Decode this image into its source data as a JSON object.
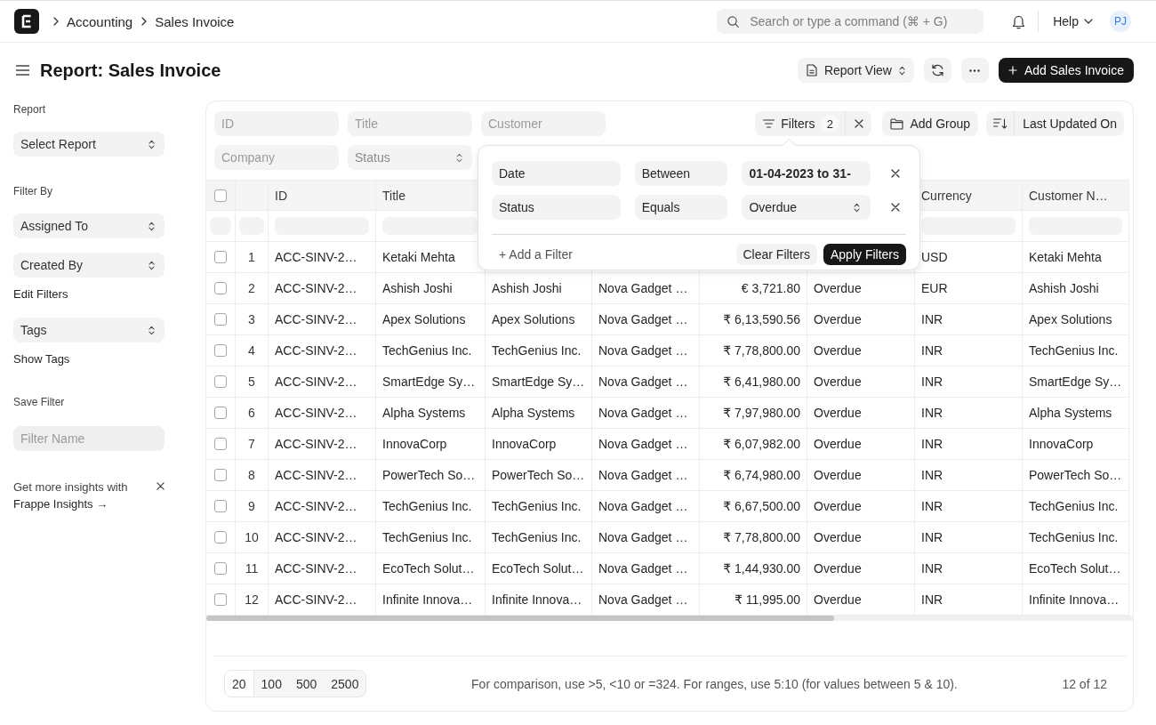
{
  "navbar": {
    "breadcrumbs": [
      "Accounting",
      "Sales Invoice"
    ],
    "search": {
      "placeholder": "Search or type a command (⌘ + G)"
    },
    "help": "Help",
    "avatar": "PJ"
  },
  "page": {
    "title": "Report: Sales Invoice",
    "view_button": "Report View",
    "primary_button": "Add Sales Invoice"
  },
  "sidebar": {
    "report_label": "Report",
    "report_select": "Select Report",
    "filter_by_label": "Filter By",
    "filter_selects": [
      "Assigned To",
      "Created By"
    ],
    "edit_filters": "Edit Filters",
    "tags_select": "Tags",
    "show_tags": "Show Tags",
    "save_filter_label": "Save Filter",
    "filter_name": {
      "placeholder": "Filter Name"
    },
    "insights": {
      "text": "Get more insights with",
      "link": "Frappe Insights →"
    }
  },
  "filter_bar": {
    "fields": [
      {
        "kind": "input",
        "placeholder": "ID"
      },
      {
        "kind": "input",
        "placeholder": "Title"
      },
      {
        "kind": "input",
        "placeholder": "Customer"
      },
      {
        "kind": "input",
        "placeholder": "Company"
      },
      {
        "kind": "select",
        "placeholder": "Status"
      }
    ],
    "filters_button": {
      "label": "Filters",
      "count": "2"
    },
    "group_button": "Add Group",
    "sort_button": "Last Updated On"
  },
  "filter_popover": {
    "filters": [
      {
        "kind": "input",
        "field": "Date",
        "condition": "Between",
        "value": "01-04-2023 to 31-"
      },
      {
        "kind": "select",
        "field": "Status",
        "condition": "Equals",
        "value": "Overdue"
      }
    ],
    "add_link": "+ Add a Filter",
    "clear_button": "Clear Filters",
    "apply_button": "Apply Filters"
  },
  "table": {
    "header_checked": false,
    "columns": [
      {
        "kind": "text",
        "label": "ID"
      },
      {
        "kind": "text",
        "label": "Title"
      },
      {
        "kind": "text"
      },
      {
        "kind": "text"
      },
      {
        "kind": "amount"
      },
      {
        "kind": "text"
      },
      {
        "kind": "text",
        "label": "Currency"
      },
      {
        "kind": "text",
        "label": "Customer N…"
      }
    ],
    "rows": [
      {
        "number": "1",
        "checked": false,
        "cells": [
          "ACC-SINV-2…",
          "Ketaki Mehta",
          null,
          null,
          null,
          null,
          "USD",
          "Ketaki Mehta"
        ]
      },
      {
        "number": "2",
        "checked": false,
        "cells": [
          "ACC-SINV-2…",
          "Ashish Joshi",
          "Ashish Joshi",
          "Nova Gadget …",
          "€ 3,721.80",
          "Overdue",
          "EUR",
          "Ashish Joshi"
        ]
      },
      {
        "number": "3",
        "checked": false,
        "cells": [
          "ACC-SINV-2…",
          "Apex Solutions",
          "Apex Solutions",
          "Nova Gadget …",
          "₹ 6,13,590.56",
          "Overdue",
          "INR",
          "Apex Solutions"
        ]
      },
      {
        "number": "4",
        "checked": false,
        "cells": [
          "ACC-SINV-2…",
          "TechGenius Inc.",
          "TechGenius Inc.",
          "Nova Gadget …",
          "₹ 7,78,800.00",
          "Overdue",
          "INR",
          "TechGenius Inc."
        ]
      },
      {
        "number": "5",
        "checked": false,
        "cells": [
          "ACC-SINV-2…",
          "SmartEdge Sy…",
          "SmartEdge Sy…",
          "Nova Gadget …",
          "₹ 6,41,980.00",
          "Overdue",
          "INR",
          "SmartEdge Sy…"
        ]
      },
      {
        "number": "6",
        "checked": false,
        "cells": [
          "ACC-SINV-2…",
          "Alpha Systems",
          "Alpha Systems",
          "Nova Gadget …",
          "₹ 7,97,980.00",
          "Overdue",
          "INR",
          "Alpha Systems"
        ]
      },
      {
        "number": "7",
        "checked": false,
        "cells": [
          "ACC-SINV-2…",
          "InnovaCorp",
          "InnovaCorp",
          "Nova Gadget …",
          "₹ 6,07,982.00",
          "Overdue",
          "INR",
          "InnovaCorp"
        ]
      },
      {
        "number": "8",
        "checked": false,
        "cells": [
          "ACC-SINV-2…",
          "PowerTech So…",
          "PowerTech So…",
          "Nova Gadget …",
          "₹ 6,74,980.00",
          "Overdue",
          "INR",
          "PowerTech So…"
        ]
      },
      {
        "number": "9",
        "checked": false,
        "cells": [
          "ACC-SINV-2…",
          "TechGenius Inc.",
          "TechGenius Inc.",
          "Nova Gadget …",
          "₹ 6,67,500.00",
          "Overdue",
          "INR",
          "TechGenius Inc."
        ]
      },
      {
        "number": "10",
        "checked": false,
        "cells": [
          "ACC-SINV-2…",
          "TechGenius Inc.",
          "TechGenius Inc.",
          "Nova Gadget …",
          "₹ 7,78,800.00",
          "Overdue",
          "INR",
          "TechGenius Inc."
        ]
      },
      {
        "number": "11",
        "checked": false,
        "cells": [
          "ACC-SINV-2…",
          "EcoTech Solut…",
          "EcoTech Solut…",
          "Nova Gadget …",
          "₹ 1,44,930.00",
          "Overdue",
          "INR",
          "EcoTech Solut…"
        ]
      },
      {
        "number": "12",
        "checked": false,
        "cells": [
          "ACC-SINV-2…",
          "Infinite Innova…",
          "Infinite Innova…",
          "Nova Gadget …",
          "₹ 11,995.00",
          "Overdue",
          "INR",
          "Infinite Innova…"
        ]
      }
    ]
  },
  "footer": {
    "page_sizes": [
      {
        "label": "20",
        "selected": true
      },
      {
        "label": "100",
        "selected": false
      },
      {
        "label": "500",
        "selected": false
      },
      {
        "label": "2500",
        "selected": false
      }
    ],
    "hint": "For comparison, use >5, <10 or =324. For ranges, use 5:10 (for values between 5 & 10).",
    "count": "12 of 12"
  }
}
